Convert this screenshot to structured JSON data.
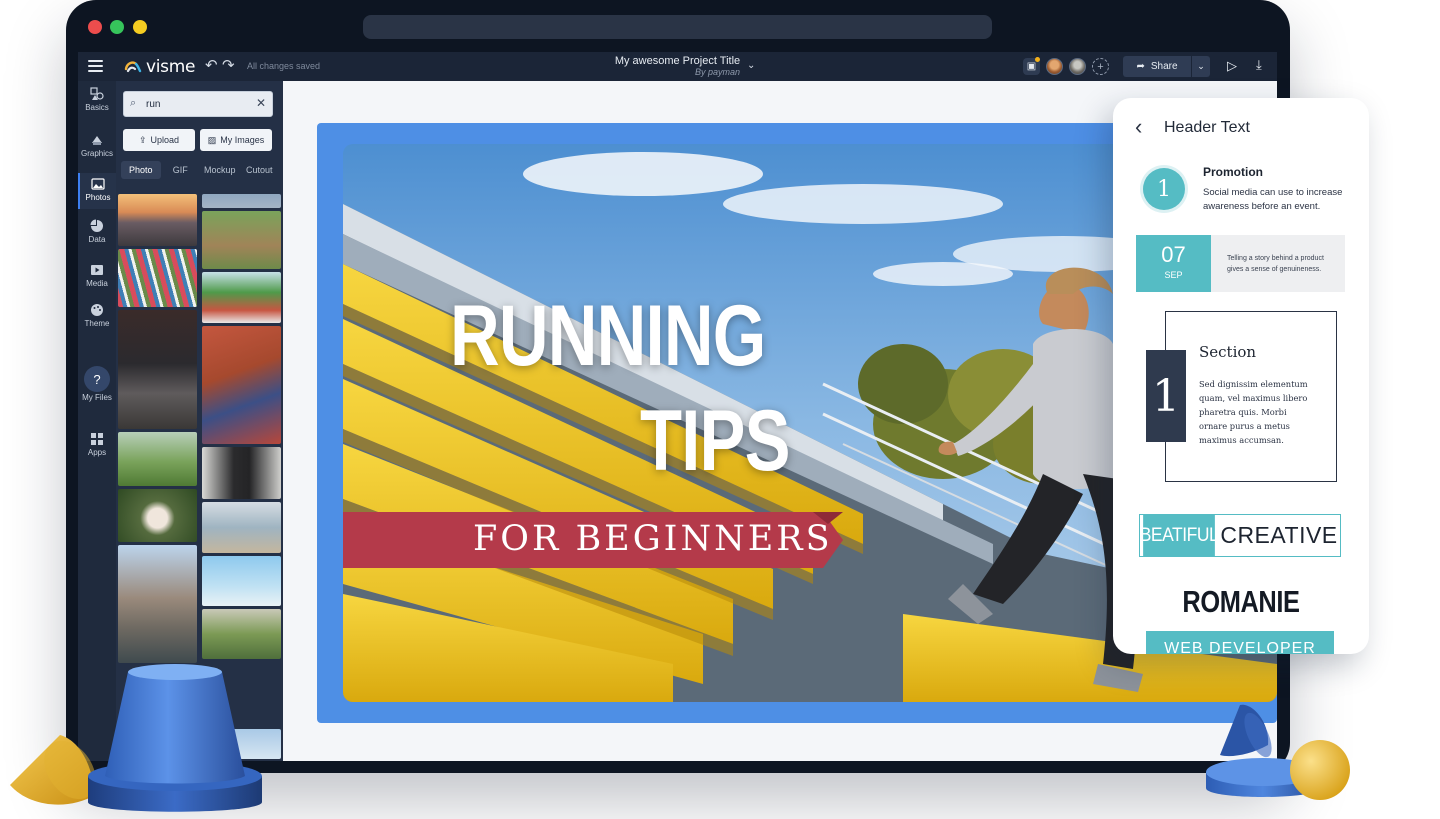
{
  "editor": {
    "logo_text": "visme",
    "save_status": "All changes saved",
    "project_title": "My awesome Project Title",
    "project_author": "By payman",
    "share_label": "Share"
  },
  "rail": {
    "items": [
      {
        "label": "Basics",
        "icon": "basics-icon"
      },
      {
        "label": "Graphics",
        "icon": "graphics-icon"
      },
      {
        "label": "Photos",
        "icon": "photos-icon",
        "active": true
      },
      {
        "label": "Data",
        "icon": "data-icon"
      },
      {
        "label": "Media",
        "icon": "media-icon"
      },
      {
        "label": "Theme",
        "icon": "theme-icon"
      },
      {
        "label": "My Files",
        "icon": "files-icon"
      },
      {
        "label": "Apps",
        "icon": "apps-icon"
      }
    ],
    "help": "?"
  },
  "panel": {
    "search_value": "run",
    "upload_label": "Upload",
    "my_images_label": "My Images",
    "tabs": [
      "Photo",
      "GIF",
      "Mockup",
      "Cutout"
    ],
    "active_tab": "Photo"
  },
  "slide": {
    "headline_line1": "RUNNING",
    "headline_line2": "TIPS",
    "ribbon_text": "FOR BEGINNERS"
  },
  "card": {
    "title": "Header Text",
    "promo_number": "1",
    "promo_heading": "Promotion",
    "promo_body": "Social media can use to increase awareness before an event.",
    "date_day": "07",
    "date_month": "SEP",
    "date_text": "Telling a story behind a product gives a sense of genuineness.",
    "section_number": "1",
    "section_heading": "Section",
    "section_body": "Sed dignissim elementum quam, vel maximus libero pharetra quis. Morbi ornare purus a metus maximus accumsan.",
    "beat_left": "BEATIFUL",
    "beat_right": "CREATIVE",
    "romanie": "ROMANIE",
    "webdev": "WEB DEVELOPER"
  },
  "colors": {
    "accent_blue": "#4e8fe5",
    "teal": "#55bcc4",
    "ribbon_red": "#b43a4a",
    "dark_chrome": "#0d1522"
  }
}
